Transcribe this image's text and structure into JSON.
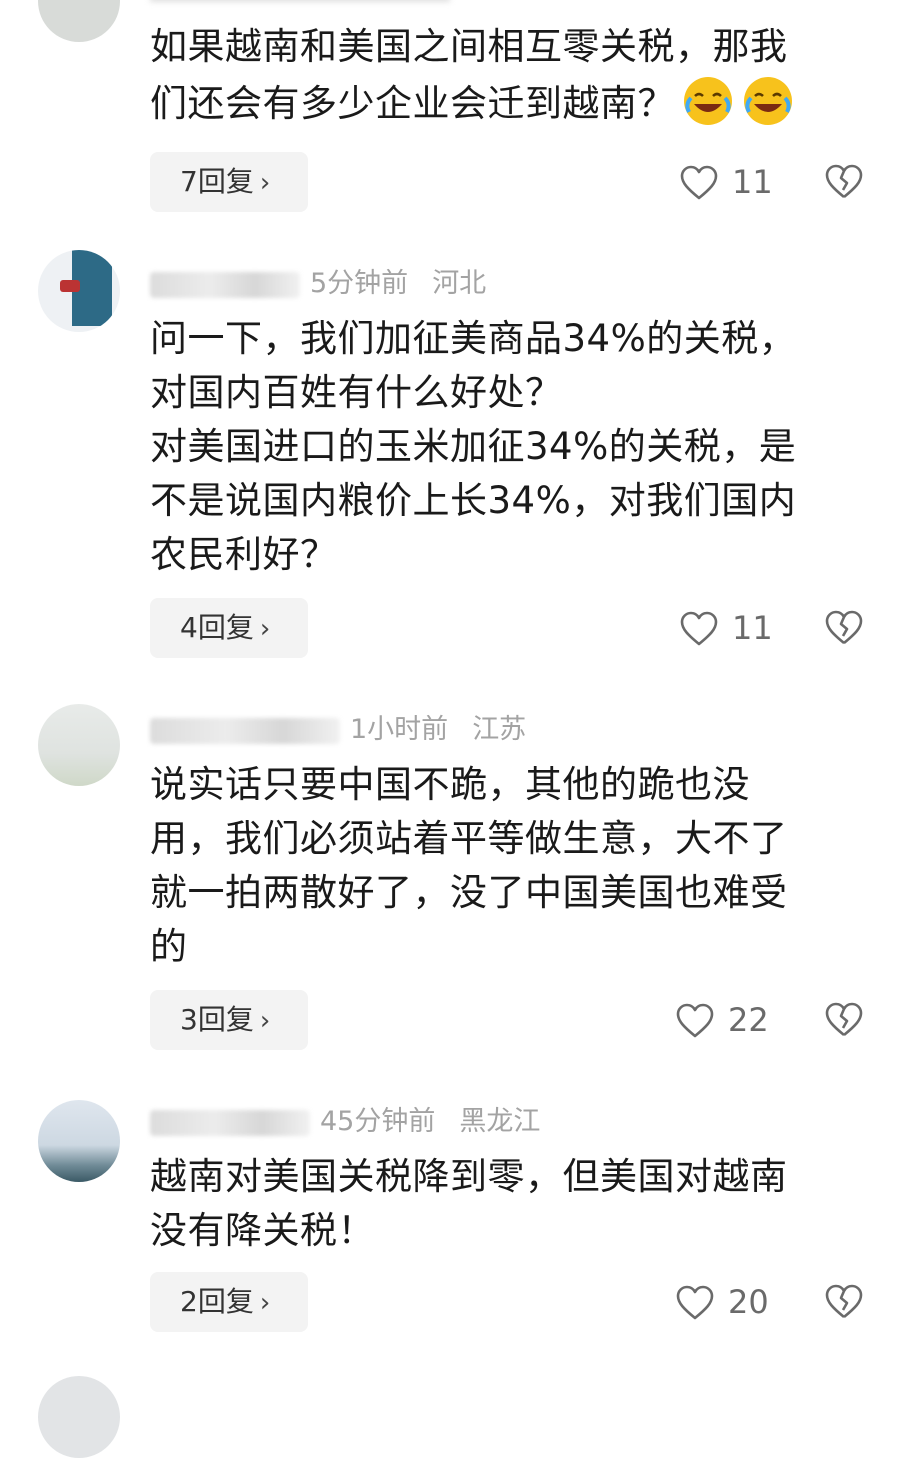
{
  "comments": [
    {
      "text_line1": "如果越南和美国之间相互零关税，那我",
      "text_line2": "们还会有多少企业会迁到越南？",
      "reply_label": "7回复",
      "likes": "11"
    },
    {
      "time": "5分钟前",
      "location": "河北",
      "text": [
        "问一下，我们加征美商品34%的关税，",
        "对国内百姓有什么好处？",
        "对美国进口的玉米加征34%的关税，是",
        "不是说国内粮价上长34%，对我们国内",
        "农民利好？"
      ],
      "reply_label": "4回复",
      "likes": "11"
    },
    {
      "time": "1小时前",
      "location": "江苏",
      "text": [
        "说实话只要中国不跪，其他的跪也没",
        "用，我们必须站着平等做生意，大不了",
        "就一拍两散好了，没了中国美国也难受",
        "的"
      ],
      "reply_label": "3回复",
      "likes": "22"
    },
    {
      "time": "45分钟前",
      "location": "黑龙江",
      "text": [
        "越南对美国关税降到零，但美国对越南",
        "没有降关税！"
      ],
      "reply_label": "2回复",
      "likes": "20"
    }
  ],
  "icons": {
    "like": "heart-outline-icon",
    "dislike": "broken-heart-icon",
    "reply_chevron": "chevron-right-icon",
    "emoji": "laughing-crying-emoji"
  },
  "colors": {
    "meta_text": "#a3a3a3",
    "reply_bg": "#f3f3f3",
    "emoji_yellow": "#f7c21c"
  }
}
